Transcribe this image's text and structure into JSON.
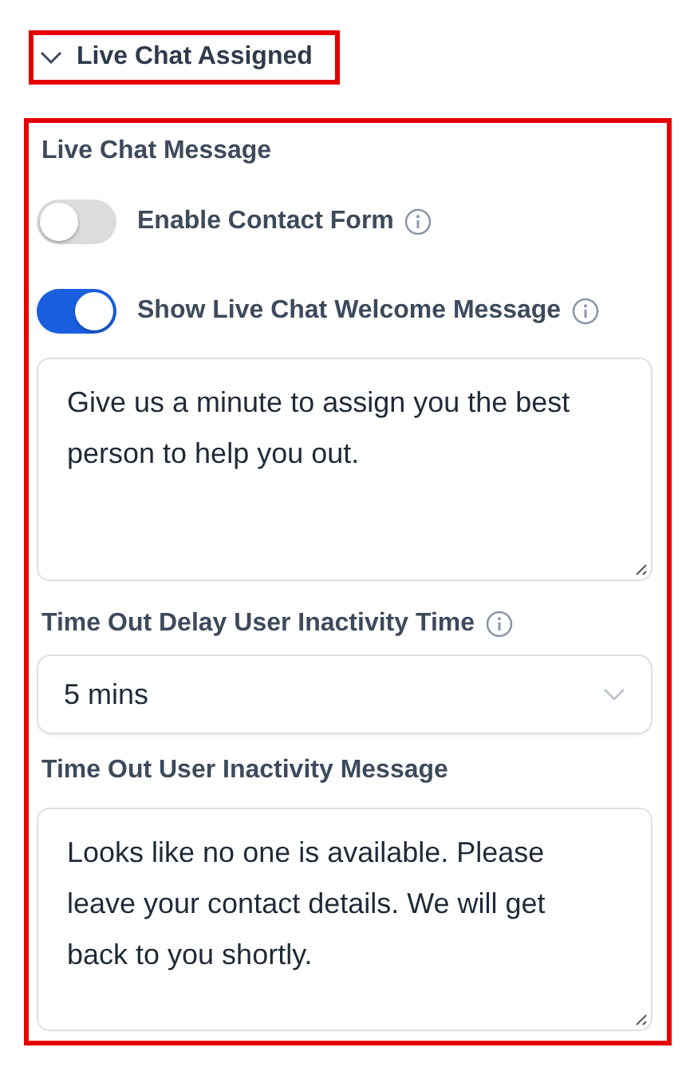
{
  "section": {
    "title": "Live Chat Assigned",
    "expanded": true
  },
  "panel": {
    "heading": "Live Chat Message",
    "fields": [
      {
        "kind": "toggle",
        "label": "Enable Contact Form",
        "on": false,
        "info": true
      },
      {
        "kind": "toggle",
        "label": "Show Live Chat Welcome Message",
        "on": true,
        "info": true
      },
      {
        "kind": "textarea",
        "value": "Give us a minute to assign you the best person to help you out."
      },
      {
        "kind": "select",
        "label": "Time Out Delay User Inactivity Time",
        "info": true,
        "value": "5 mins"
      },
      {
        "kind": "textarea",
        "label": "Time Out User Inactivity Message",
        "value": "Looks like no one is available. Please leave your contact details. We will get back to you shortly."
      }
    ]
  }
}
